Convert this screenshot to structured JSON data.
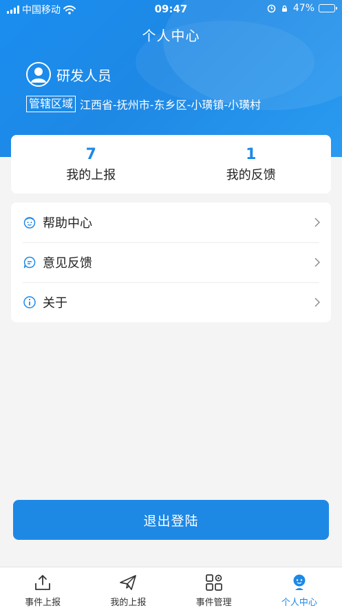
{
  "status_bar": {
    "carrier": "中国移动",
    "time": "09:47",
    "battery": "47%",
    "battery_level": 0.47
  },
  "header": {
    "title": "个人中心"
  },
  "user": {
    "name": "研发人员",
    "region_tag": "管辖区域",
    "region": "江西省-抚州市-东乡区-小璜镇-小璜村"
  },
  "stats": [
    {
      "value": "7",
      "label": "我的上报"
    },
    {
      "value": "1",
      "label": "我的反馈"
    }
  ],
  "menu": [
    {
      "label": "帮助中心",
      "icon": "help-face-icon"
    },
    {
      "label": "意见反馈",
      "icon": "chat-bubble-icon"
    },
    {
      "label": "关于",
      "icon": "info-icon"
    }
  ],
  "logout_label": "退出登陆",
  "tabs": [
    {
      "label": "事件上报",
      "icon": "upload-icon",
      "active": false
    },
    {
      "label": "我的上报",
      "icon": "paper-plane-icon",
      "active": false
    },
    {
      "label": "事件管理",
      "icon": "grid-gear-icon",
      "active": false
    },
    {
      "label": "个人中心",
      "icon": "person-icon",
      "active": true
    }
  ],
  "colors": {
    "primary": "#1e88e5",
    "background": "#f4f4f4"
  }
}
